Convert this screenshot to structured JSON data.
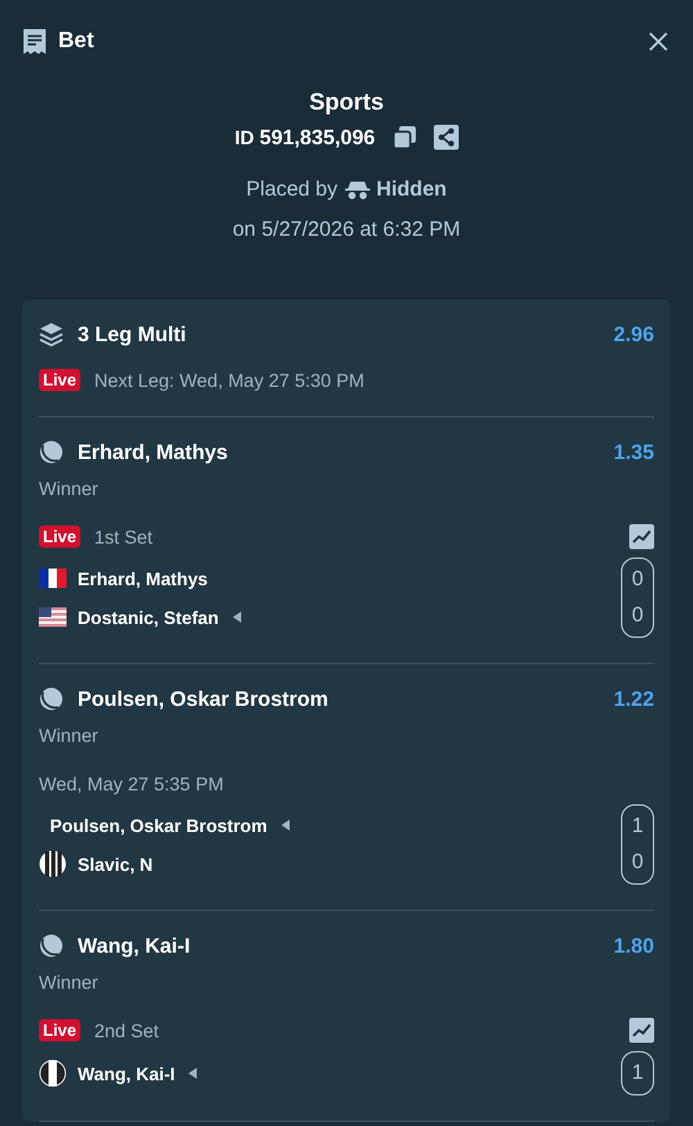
{
  "header": {
    "title": "Bet"
  },
  "summary": {
    "category": "Sports",
    "id_label": "ID",
    "id_value": "591,835,096",
    "placed_by_label": "Placed by",
    "placed_by": "Hidden",
    "placed_on": "on 5/27/2026 at 6:32 PM"
  },
  "multi": {
    "title": "3 Leg Multi",
    "odds": "2.96",
    "live": true,
    "live_label": "Live",
    "next_leg": "Next Leg: Wed, May 27 5:30 PM"
  },
  "legs": [
    {
      "selection": "Erhard, Mathys",
      "odds": "1.35",
      "market": "Winner",
      "live": true,
      "live_label": "Live",
      "status": "1st Set",
      "competitors": [
        {
          "name": "Erhard, Mathys",
          "kind": "fr",
          "serving": false,
          "score": "0"
        },
        {
          "name": "Dostanic, Stefan",
          "kind": "us",
          "serving": true,
          "score": "0"
        }
      ]
    },
    {
      "selection": "Poulsen, Oskar Brostrom",
      "odds": "1.22",
      "market": "Winner",
      "live": false,
      "status": "Wed, May 27  5:35 PM",
      "competitors": [
        {
          "name": "Poulsen, Oskar Brostrom",
          "kind": "none",
          "serving": true,
          "score": "1"
        },
        {
          "name": "Slavic, N",
          "kind": "stripes",
          "serving": false,
          "score": "0"
        }
      ]
    },
    {
      "selection": "Wang, Kai-I",
      "odds": "1.80",
      "market": "Winner",
      "live": true,
      "live_label": "Live",
      "status": "2nd Set",
      "competitors": [
        {
          "name": "Wang, Kai-I",
          "kind": "band",
          "serving": true,
          "score": "1"
        }
      ]
    }
  ]
}
